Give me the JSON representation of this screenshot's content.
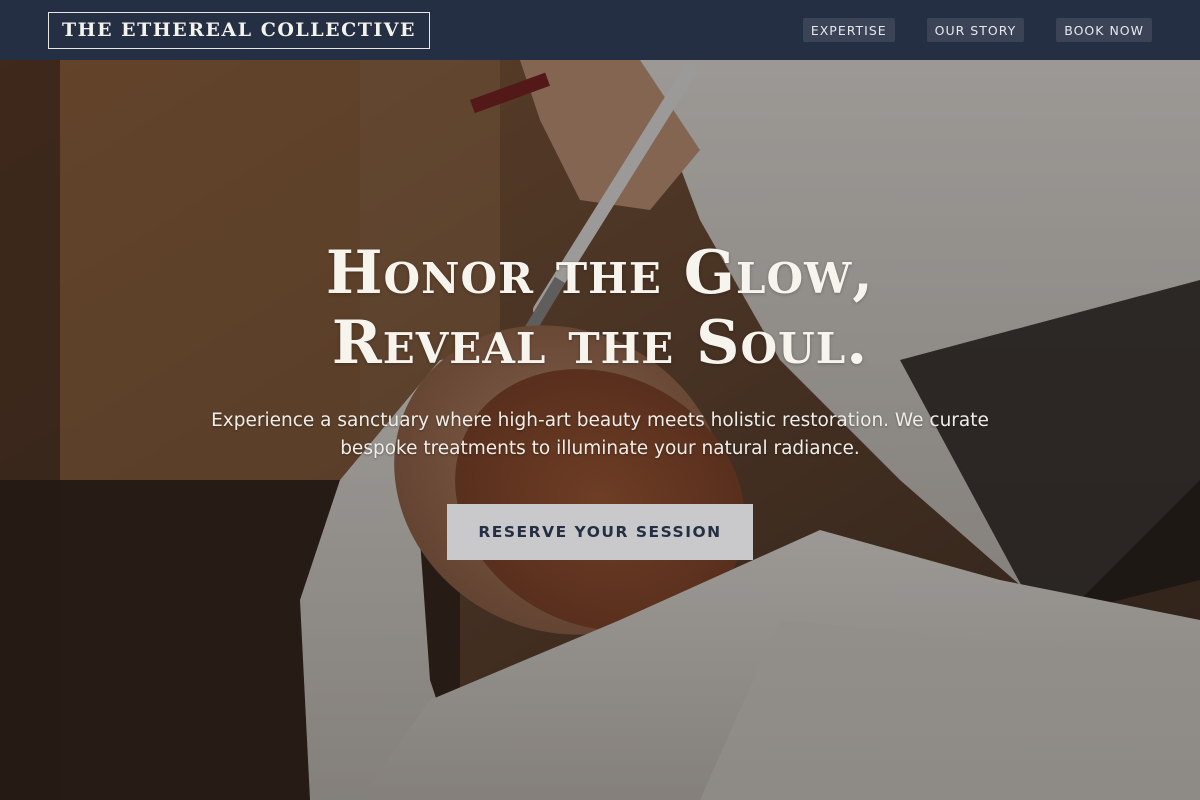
{
  "header": {
    "logo": "THE ETHEREAL COLLECTIVE",
    "nav": [
      {
        "label": "EXPERTISE"
      },
      {
        "label": "OUR STORY"
      },
      {
        "label": "BOOK NOW"
      }
    ]
  },
  "hero": {
    "headline_line1": "Honor the Glow,",
    "headline_line2": "Reveal the Soul.",
    "subtext": "Experience a sanctuary where high-art beauty meets holistic restoration. We curate bespoke treatments to illuminate your natural radiance.",
    "cta_label": "RESERVE YOUR SESSION"
  },
  "colors": {
    "header_bg": "#252f43",
    "cta_bg": "#c9c9cb",
    "cta_text": "#252f43"
  }
}
